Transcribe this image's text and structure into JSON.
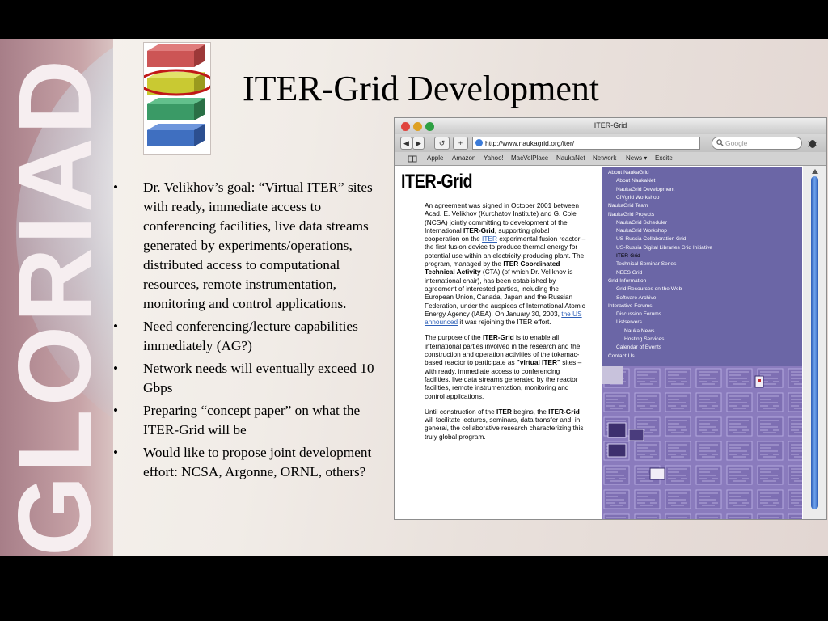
{
  "side_word": "GLORIAD",
  "title": "ITER-Grid Development",
  "bullet_glyph": "•",
  "bullets": [
    "Dr. Velikhov’s goal:  “Virtual ITER” sites with ready, immediate access to conferencing facilities, live data streams generated by experiments/operations, distributed access to computational resources, remote instrumentation, monitoring and control applications.",
    "Need conferencing/lecture capabilities immediately (AG?)",
    "Network needs will eventually exceed 10 Gbps",
    "Preparing “concept paper” on what the ITER-Grid will be",
    "Would like to propose joint development effort: NCSA, Argonne, ORNL, others?"
  ],
  "browser": {
    "window_title": "ITER-Grid",
    "url": "http://www.naukagrid.org/iter/",
    "search_placeholder": "Google",
    "nav_buttons": [
      "◀",
      "▶",
      "↺",
      "+"
    ],
    "bookmarks": [
      "Apple",
      "Amazon",
      "Yahoo!",
      "MacVolPlace",
      "NaukaNet",
      "Network",
      "News ▾",
      "Excite"
    ],
    "page_title": "ITER-Grid",
    "p1": {
      "t1": "An agreement was signed in October 2001 between Acad. E. Velikhov (Kurchatov Institute) and G. Cole (NCSA) jointly committing to development of the International ",
      "b1": "ITER-Grid",
      "t2": ", supporting global cooperation on the ",
      "l1": "ITER",
      "t3": " experimental fusion reactor – the first fusion device to produce thermal energy for potential use within an electricity-producing plant. The program, managed by the ",
      "b2": "ITER Coordinated Technical Activity",
      "t4": " (CTA) (of which Dr. Velikhov is international chair), has been established by agreement of interested parties, including the European Union, Canada, Japan and the Russian Federation, under the auspices of International Atomic Energy Agency (IAEA). On January 30, 2003, ",
      "l2": "the US announced",
      "t5": " it was rejoining the ITER effort."
    },
    "p2": {
      "t1": "The purpose of the ",
      "b1": "ITER-Grid",
      "t2": " is to enable all international parties involved in the research and the construction and operation activities of the tokamac-based reactor to participate as ",
      "b2": "\"virtual ITER\"",
      "t3": " sites – with ready, immediate access to conferencing facilities, live data streams generated by the reactor facilities, remote instrumentation, monitoring and control applications."
    },
    "p3": {
      "t1": "Until construction of the ",
      "b1": "ITER",
      "t2": " begins, the ",
      "b2": "ITER-Grid",
      "t3": " will facilitate lectures, seminars, data transfer and, in general, the collaborative research characterizing this truly global program."
    },
    "nav": [
      {
        "label": "About NaukaGrid",
        "indent": 0
      },
      {
        "label": "About NaukaNet",
        "indent": 1
      },
      {
        "label": "NaukaGrid Development",
        "indent": 1
      },
      {
        "label": "CIVgrid Workshop",
        "indent": 1
      },
      {
        "label": "NaukaGrid Team",
        "indent": 0
      },
      {
        "label": "NaukaGrid Projects",
        "indent": 0
      },
      {
        "label": "NaukaGrid Scheduler",
        "indent": 1
      },
      {
        "label": "NaukaGrid Workshop",
        "indent": 1
      },
      {
        "label": "US-Russia Collaboration Grid",
        "indent": 1
      },
      {
        "label": "US-Russia Digital Libraries Grid Initiative",
        "indent": 1
      },
      {
        "label": "ITER-Grid",
        "indent": 1,
        "active": true
      },
      {
        "label": "Technical Seminar Series",
        "indent": 1
      },
      {
        "label": "NEES Grid",
        "indent": 1
      },
      {
        "label": "Grid Information",
        "indent": 0
      },
      {
        "label": "Grid Resources on the Web",
        "indent": 1
      },
      {
        "label": "Software Archive",
        "indent": 1
      },
      {
        "label": "Interactive Forums",
        "indent": 0
      },
      {
        "label": "Discussion Forums",
        "indent": 1
      },
      {
        "label": "Listservers",
        "indent": 1
      },
      {
        "label": "Nauka News",
        "indent": 2
      },
      {
        "label": "Hosting Services",
        "indent": 2
      },
      {
        "label": "Calendar of Events",
        "indent": 1
      },
      {
        "label": "Contact Us",
        "indent": 0
      }
    ]
  }
}
